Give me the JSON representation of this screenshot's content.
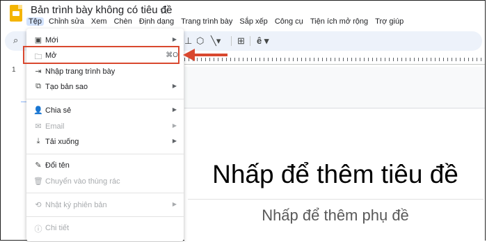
{
  "app": {
    "title": "Bản trình bày không có tiêu đề",
    "star_icon": "star-icon",
    "logo_icon": "slides-logo-icon"
  },
  "menubar": {
    "items": [
      "Tệp",
      "Chỉnh sửa",
      "Xem",
      "Chèn",
      "Định dạng",
      "Trang trình bày",
      "Sắp xếp",
      "Công cụ",
      "Tiện ích mở rộng",
      "Trợ giúp"
    ],
    "active": "Tệp"
  },
  "toolbar": {
    "icons": [
      "search-icon",
      "shape-icon",
      "line-icon",
      "comment-icon",
      "text-format-icon"
    ]
  },
  "sidebar": {
    "slide_number": "1"
  },
  "file_menu": {
    "items": [
      {
        "label": "Mới",
        "icon": "new-icon",
        "submenu": true
      },
      {
        "label": "Mở",
        "icon": "folder-icon",
        "shortcut": "⌘O"
      },
      {
        "label": "Nhập trang trình bày",
        "icon": "import-icon"
      },
      {
        "label": "Tạo bản sao",
        "icon": "copy-icon",
        "submenu": true
      },
      {
        "label": "Chia sẻ",
        "icon": "share-icon",
        "submenu": true
      },
      {
        "label": "Email",
        "icon": "email-icon",
        "submenu": true,
        "disabled": true
      },
      {
        "label": "Tải xuống",
        "icon": "download-icon",
        "submenu": true
      },
      {
        "label": "Đổi tên",
        "icon": "rename-icon"
      },
      {
        "label": "Chuyển vào thùng rác",
        "icon": "trash-icon",
        "disabled": true
      },
      {
        "label": "Nhật ký phiên bản",
        "icon": "history-icon",
        "submenu": true,
        "disabled": true
      },
      {
        "label": "Chi tiết",
        "icon": "info-icon",
        "disabled": true
      }
    ]
  },
  "slide": {
    "title_placeholder": "Nhấp để thêm tiêu đề",
    "subtitle_placeholder": "Nhấp để thêm phụ đề"
  },
  "annotation": {
    "color": "#d9482f"
  }
}
